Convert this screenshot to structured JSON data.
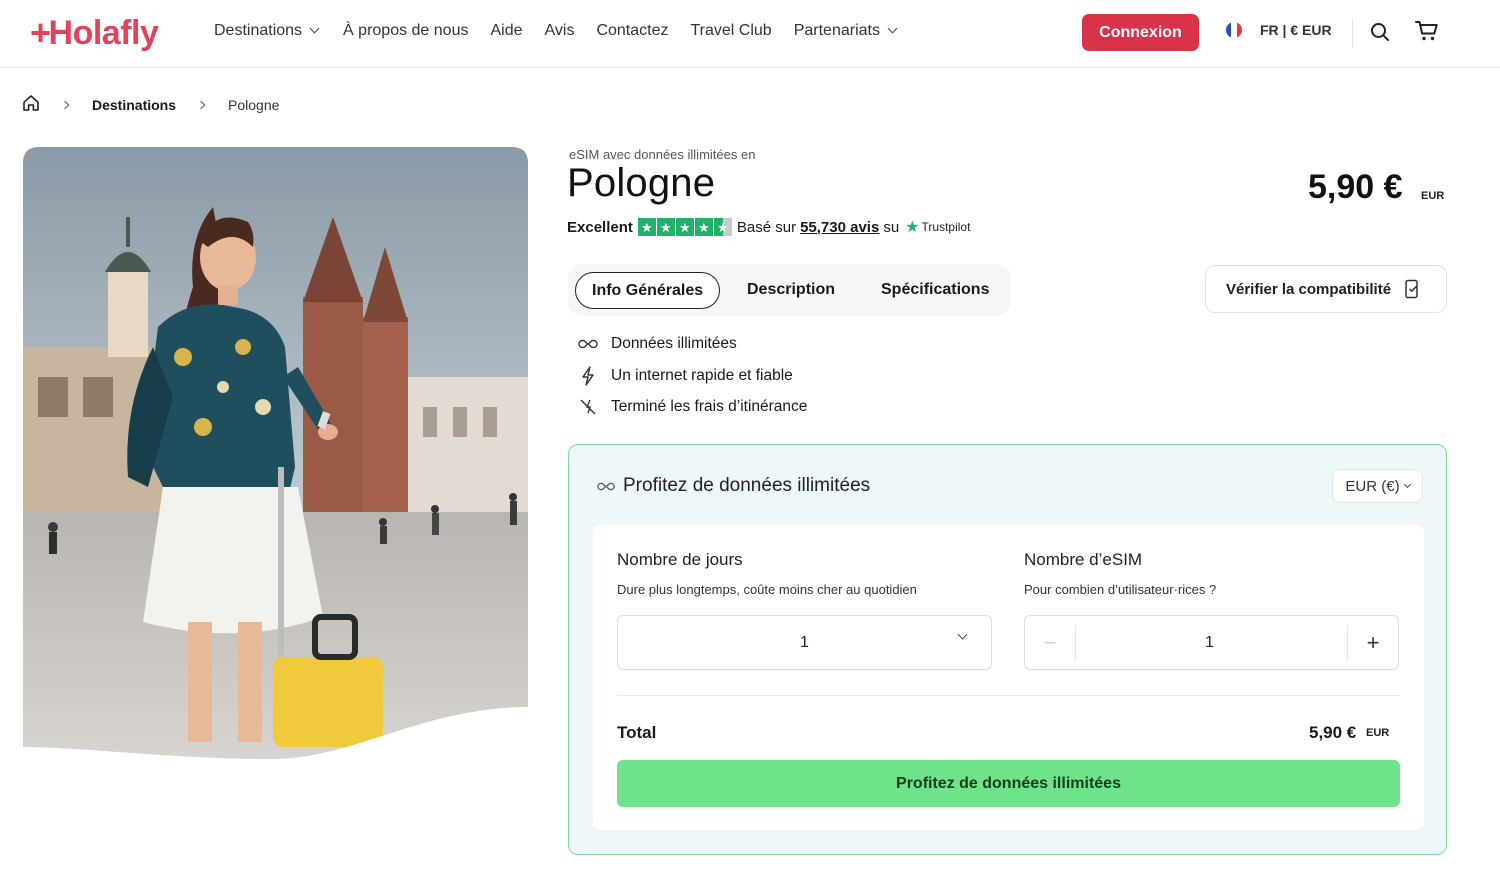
{
  "header": {
    "logo": "Holafly",
    "nav": [
      {
        "label": "Destinations",
        "dropdown": true
      },
      {
        "label": "À propos de nous",
        "dropdown": false
      },
      {
        "label": "Aide",
        "dropdown": false
      },
      {
        "label": "Avis",
        "dropdown": false
      },
      {
        "label": "Contactez",
        "dropdown": false
      },
      {
        "label": "Travel Club",
        "dropdown": false
      },
      {
        "label": "Partenariats",
        "dropdown": true
      }
    ],
    "login": "Connexion",
    "lang": "FR | € EUR",
    "icons": [
      "search-icon",
      "cart-icon"
    ]
  },
  "breadcrumb": {
    "home_icon": "home-icon",
    "items": [
      "Destinations",
      "Pologne"
    ]
  },
  "hero": {
    "image": "woman-in-krakow-square-with-suitcase"
  },
  "product": {
    "subtitle": "eSIM avec données illimitées en",
    "title": "Pologne",
    "price": "5,90 €",
    "currency": "EUR",
    "rating": {
      "label": "Excellent",
      "based_on": "Basé sur",
      "count": "55,730 avis",
      "on": "su",
      "source": "Trustpilot",
      "stars": 4.5
    }
  },
  "tabs": [
    {
      "label": "Info Générales",
      "active": true
    },
    {
      "label": "Description",
      "active": false
    },
    {
      "label": "Spécifications",
      "active": false
    }
  ],
  "compat_button": "Vérifier la compatibilité",
  "features": [
    {
      "icon": "infinity-icon",
      "label": "Données illimitées"
    },
    {
      "icon": "lightning-icon",
      "label": "Un internet rapide et fiable"
    },
    {
      "icon": "no-roaming-icon",
      "label": "Terminé les frais d’itinérance"
    }
  ],
  "plan": {
    "heading": "Profitez de données illimitées",
    "currency_select": "EUR (€)",
    "days": {
      "title": "Nombre de jours",
      "subtitle": "Dure plus longtemps, coûte moins cher au quotidien",
      "value": "1"
    },
    "esims": {
      "title": "Nombre d’eSIM",
      "subtitle": "Pour combien d’utilisateur·rices ?",
      "value": "1",
      "minus": "−",
      "plus": "+"
    },
    "total_label": "Total",
    "total_value": "5,90 €",
    "total_currency": "EUR",
    "cta": "Profitez de données illimitées"
  },
  "colors": {
    "brand": "#e0445a",
    "login": "#d9334c",
    "cta": "#6fe38a",
    "card_border": "#7fd9a0",
    "card_bg": "#eef7fa",
    "trustpilot": "#1fb36a"
  }
}
